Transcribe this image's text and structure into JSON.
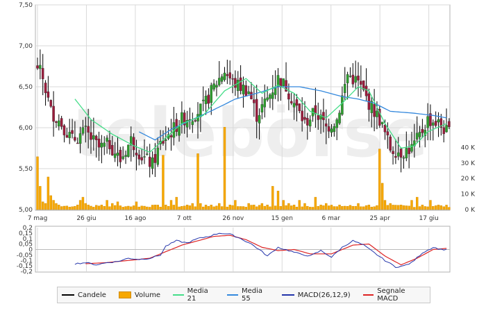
{
  "chart_data": [
    {
      "type": "candlestick",
      "y_ticks": [
        "7,50",
        "7,00",
        "6,50",
        "6,00",
        "5,50",
        "5,00"
      ],
      "ylim": [
        5.0,
        7.5
      ],
      "x_ticks": [
        "7 mag",
        "26 giu",
        "16 ago",
        "7 ott",
        "26 nov",
        "15 gen",
        "6 mar",
        "25 apr",
        "17 giu"
      ],
      "close_anchors": [
        [
          0,
          6.75
        ],
        [
          2,
          6.6
        ],
        [
          5,
          6.2
        ],
        [
          9,
          6.05
        ],
        [
          13,
          5.85
        ],
        [
          18,
          5.95
        ],
        [
          23,
          5.75
        ],
        [
          27,
          5.8
        ],
        [
          31,
          5.6
        ],
        [
          35,
          5.85
        ],
        [
          39,
          5.65
        ],
        [
          43,
          5.55
        ],
        [
          46,
          5.8
        ],
        [
          50,
          5.95
        ],
        [
          54,
          6.1
        ],
        [
          58,
          6.15
        ],
        [
          62,
          6.25
        ],
        [
          66,
          6.5
        ],
        [
          70,
          6.7
        ],
        [
          73,
          6.55
        ],
        [
          76,
          6.5
        ],
        [
          79,
          6.45
        ],
        [
          82,
          6.15
        ],
        [
          86,
          6.35
        ],
        [
          90,
          6.6
        ],
        [
          93,
          6.5
        ],
        [
          96,
          6.3
        ],
        [
          100,
          6.05
        ],
        [
          104,
          6.2
        ],
        [
          108,
          6.0
        ],
        [
          112,
          6.1
        ],
        [
          116,
          6.65
        ],
        [
          120,
          6.55
        ],
        [
          124,
          6.3
        ],
        [
          128,
          6.1
        ],
        [
          132,
          5.75
        ],
        [
          136,
          5.7
        ],
        [
          140,
          5.75
        ],
        [
          143,
          5.9
        ],
        [
          146,
          6.1
        ],
        [
          150,
          6.05
        ],
        [
          153,
          5.95
        ]
      ],
      "ma21_anchors": [
        [
          14,
          6.35
        ],
        [
          20,
          6.1
        ],
        [
          28,
          5.92
        ],
        [
          36,
          5.78
        ],
        [
          42,
          5.7
        ],
        [
          47,
          5.85
        ],
        [
          54,
          6.05
        ],
        [
          62,
          6.15
        ],
        [
          70,
          6.45
        ],
        [
          78,
          6.6
        ],
        [
          84,
          6.42
        ],
        [
          90,
          6.52
        ],
        [
          96,
          6.42
        ],
        [
          102,
          6.2
        ],
        [
          108,
          6.12
        ],
        [
          114,
          6.3
        ],
        [
          120,
          6.5
        ],
        [
          124,
          6.45
        ],
        [
          130,
          6.05
        ],
        [
          136,
          5.75
        ],
        [
          141,
          5.78
        ],
        [
          146,
          5.95
        ],
        [
          153,
          6.05
        ]
      ],
      "ma55_anchors": [
        [
          38,
          5.95
        ],
        [
          44,
          5.85
        ],
        [
          50,
          5.98
        ],
        [
          58,
          6.1
        ],
        [
          66,
          6.22
        ],
        [
          74,
          6.35
        ],
        [
          82,
          6.42
        ],
        [
          90,
          6.5
        ],
        [
          98,
          6.5
        ],
        [
          106,
          6.45
        ],
        [
          114,
          6.38
        ],
        [
          120,
          6.35
        ],
        [
          126,
          6.3
        ],
        [
          132,
          6.2
        ],
        [
          140,
          6.18
        ],
        [
          148,
          6.15
        ],
        [
          153,
          6.12
        ]
      ],
      "series_names": [
        "Candele",
        "Media 21",
        "Media 55"
      ]
    },
    {
      "type": "bar",
      "name": "Volume",
      "y_ticks": [
        "40 K",
        "30 K",
        "20 K",
        "10 K",
        "0 K"
      ],
      "ylim": [
        0,
        50000
      ],
      "spikes": [
        [
          0,
          34000
        ],
        [
          1,
          15000
        ],
        [
          2,
          5000
        ],
        [
          3,
          4000
        ],
        [
          4,
          21000
        ],
        [
          5,
          9000
        ],
        [
          6,
          6000
        ],
        [
          7,
          4000
        ],
        [
          8,
          3000
        ],
        [
          9,
          2000
        ],
        [
          15,
          3000
        ],
        [
          16,
          6000
        ],
        [
          17,
          8000
        ],
        [
          18,
          4000
        ],
        [
          19,
          3000
        ],
        [
          24,
          3000
        ],
        [
          26,
          6000
        ],
        [
          28,
          4000
        ],
        [
          30,
          5000
        ],
        [
          33,
          2000
        ],
        [
          37,
          5000
        ],
        [
          44,
          3000
        ],
        [
          47,
          35000
        ],
        [
          48,
          3000
        ],
        [
          50,
          6000
        ],
        [
          52,
          8000
        ],
        [
          56,
          3000
        ],
        [
          58,
          4000
        ],
        [
          60,
          36000
        ],
        [
          61,
          4000
        ],
        [
          65,
          3000
        ],
        [
          68,
          4000
        ],
        [
          70,
          53000
        ],
        [
          72,
          3000
        ],
        [
          74,
          6000
        ],
        [
          77,
          2000
        ],
        [
          79,
          4000
        ],
        [
          81,
          3000
        ],
        [
          84,
          4000
        ],
        [
          86,
          3000
        ],
        [
          88,
          15000
        ],
        [
          90,
          12000
        ],
        [
          92,
          6000
        ],
        [
          94,
          4000
        ],
        [
          96,
          3000
        ],
        [
          98,
          6000
        ],
        [
          100,
          4000
        ],
        [
          104,
          8000
        ],
        [
          106,
          3000
        ],
        [
          108,
          4000
        ],
        [
          111,
          2000
        ],
        [
          113,
          3000
        ],
        [
          120,
          4000
        ],
        [
          124,
          3000
        ],
        [
          128,
          39000
        ],
        [
          129,
          17000
        ],
        [
          130,
          6000
        ],
        [
          132,
          4000
        ],
        [
          136,
          3000
        ],
        [
          140,
          6000
        ],
        [
          142,
          8000
        ],
        [
          144,
          3000
        ],
        [
          147,
          6000
        ],
        [
          150,
          3000
        ]
      ]
    },
    {
      "type": "line",
      "y_ticks": [
        "0,2",
        "0,15",
        "0,1",
        "0,05",
        "0",
        "-0,05",
        "-0,1",
        "-0,15",
        "-0,2"
      ],
      "ylim": [
        -0.2,
        0.2
      ],
      "macd_anchors": [
        [
          14,
          -0.13
        ],
        [
          18,
          -0.12
        ],
        [
          22,
          -0.14
        ],
        [
          26,
          -0.12
        ],
        [
          30,
          -0.11
        ],
        [
          34,
          -0.08
        ],
        [
          38,
          -0.09
        ],
        [
          42,
          -0.08
        ],
        [
          46,
          -0.05
        ],
        [
          48,
          0.03
        ],
        [
          52,
          0.08
        ],
        [
          56,
          0.06
        ],
        [
          60,
          0.1
        ],
        [
          64,
          0.12
        ],
        [
          68,
          0.15
        ],
        [
          72,
          0.14
        ],
        [
          76,
          0.1
        ],
        [
          80,
          0.05
        ],
        [
          84,
          -0.02
        ],
        [
          86,
          -0.06
        ],
        [
          90,
          0.02
        ],
        [
          94,
          -0.01
        ],
        [
          98,
          -0.04
        ],
        [
          102,
          -0.06
        ],
        [
          106,
          -0.01
        ],
        [
          110,
          -0.07
        ],
        [
          114,
          0.02
        ],
        [
          118,
          0.08
        ],
        [
          122,
          0.04
        ],
        [
          126,
          -0.03
        ],
        [
          130,
          -0.1
        ],
        [
          134,
          -0.16
        ],
        [
          137,
          -0.15
        ],
        [
          140,
          -0.12
        ],
        [
          144,
          -0.03
        ],
        [
          148,
          0.02
        ],
        [
          151,
          0.0
        ],
        [
          153,
          0.0
        ]
      ],
      "signal_anchors": [
        [
          18,
          -0.13
        ],
        [
          26,
          -0.12
        ],
        [
          34,
          -0.1
        ],
        [
          42,
          -0.08
        ],
        [
          48,
          -0.02
        ],
        [
          54,
          0.04
        ],
        [
          60,
          0.08
        ],
        [
          66,
          0.12
        ],
        [
          72,
          0.13
        ],
        [
          78,
          0.09
        ],
        [
          84,
          0.02
        ],
        [
          90,
          -0.01
        ],
        [
          96,
          0.0
        ],
        [
          102,
          -0.04
        ],
        [
          110,
          -0.04
        ],
        [
          118,
          0.04
        ],
        [
          124,
          0.05
        ],
        [
          130,
          -0.06
        ],
        [
          136,
          -0.14
        ],
        [
          142,
          -0.08
        ],
        [
          148,
          0.0
        ],
        [
          153,
          0.01
        ]
      ],
      "series_names": [
        "MACD(26,12,9)",
        "Segnale MACD"
      ]
    }
  ],
  "legend": {
    "candele": "Candele",
    "volume": "Volume",
    "media21": "Media 21",
    "media55": "Media 55",
    "macd": "MACD(26,12,9)",
    "segnale": "Segnale MACD"
  },
  "colors": {
    "candle_up": "#2e9e2e",
    "candle_down": "#9a1c3c",
    "wick": "#000000",
    "volume": "#f7a800",
    "media21": "#44dd88",
    "media55": "#3388dd",
    "macd": "#2233aa",
    "segnale": "#dd2222",
    "grid": "#d9d9d9"
  }
}
